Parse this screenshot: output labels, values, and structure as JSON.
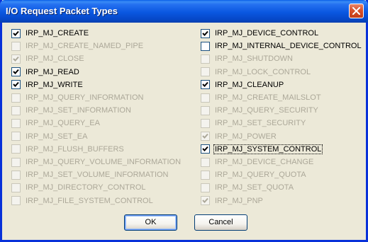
{
  "window": {
    "title": "I/O Request Packet Types"
  },
  "left_items": [
    {
      "label": "IRP_MJ_CREATE",
      "checked": true,
      "enabled": true
    },
    {
      "label": "IRP_MJ_CREATE_NAMED_PIPE",
      "checked": false,
      "enabled": false
    },
    {
      "label": "IRP_MJ_CLOSE",
      "checked": true,
      "enabled": false
    },
    {
      "label": "IRP_MJ_READ",
      "checked": true,
      "enabled": true
    },
    {
      "label": "IRP_MJ_WRITE",
      "checked": true,
      "enabled": true
    },
    {
      "label": "IRP_MJ_QUERY_INFORMATION",
      "checked": false,
      "enabled": false
    },
    {
      "label": "IRP_MJ_SET_INFORMATION",
      "checked": false,
      "enabled": false
    },
    {
      "label": "IRP_MJ_QUERY_EA",
      "checked": false,
      "enabled": false
    },
    {
      "label": "IRP_MJ_SET_EA",
      "checked": false,
      "enabled": false
    },
    {
      "label": "IRP_MJ_FLUSH_BUFFERS",
      "checked": false,
      "enabled": false
    },
    {
      "label": "IRP_MJ_QUERY_VOLUME_INFORMATION",
      "checked": false,
      "enabled": false
    },
    {
      "label": "IRP_MJ_SET_VOLUME_INFORMATION",
      "checked": false,
      "enabled": false
    },
    {
      "label": "IRP_MJ_DIRECTORY_CONTROL",
      "checked": false,
      "enabled": false
    },
    {
      "label": "IRP_MJ_FILE_SYSTEM_CONTROL",
      "checked": false,
      "enabled": false
    }
  ],
  "right_items": [
    {
      "label": "IRP_MJ_DEVICE_CONTROL",
      "checked": true,
      "enabled": true
    },
    {
      "label": "IRP_MJ_INTERNAL_DEVICE_CONTROL",
      "checked": false,
      "enabled": true
    },
    {
      "label": "IRP_MJ_SHUTDOWN",
      "checked": false,
      "enabled": false
    },
    {
      "label": "IRP_MJ_LOCK_CONTROL",
      "checked": false,
      "enabled": false
    },
    {
      "label": "IRP_MJ_CLEANUP",
      "checked": true,
      "enabled": true
    },
    {
      "label": "IRP_MJ_CREATE_MAILSLOT",
      "checked": false,
      "enabled": false
    },
    {
      "label": "IRP_MJ_QUERY_SECURITY",
      "checked": false,
      "enabled": false
    },
    {
      "label": "IRP_MJ_SET_SECURITY",
      "checked": false,
      "enabled": false
    },
    {
      "label": "IRP_MJ_POWER",
      "checked": true,
      "enabled": false
    },
    {
      "label": "IRP_MJ_SYSTEM_CONTROL",
      "checked": true,
      "enabled": true,
      "focused": true
    },
    {
      "label": "IRP_MJ_DEVICE_CHANGE",
      "checked": false,
      "enabled": false
    },
    {
      "label": "IRP_MJ_QUERY_QUOTA",
      "checked": false,
      "enabled": false
    },
    {
      "label": "IRP_MJ_SET_QUOTA",
      "checked": false,
      "enabled": false
    },
    {
      "label": "IRP_MJ_PNP",
      "checked": true,
      "enabled": false
    }
  ],
  "buttons": {
    "ok_label": "OK",
    "cancel_label": "Cancel"
  },
  "colors": {
    "title_bar": "#0a57e0",
    "dialog_face": "#ece9d8",
    "disabled_text": "#aca899",
    "check_enabled": "#000000",
    "check_disabled": "#aca899"
  },
  "icons": {
    "close": "close-icon",
    "check": "checkmark-icon"
  }
}
